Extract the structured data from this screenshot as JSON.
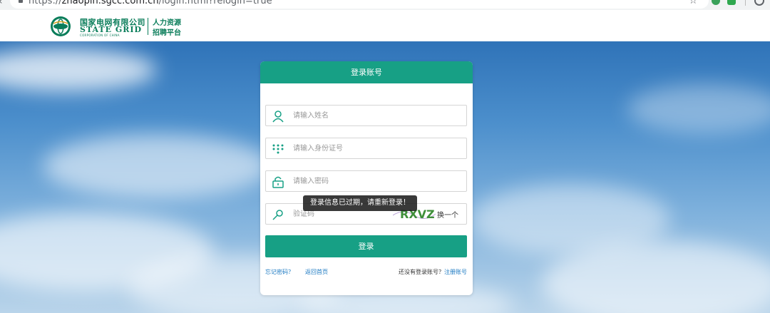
{
  "browser": {
    "url_prefix": "https://",
    "url_host": "zhaopin.sgcc.com.cn",
    "url_path": "/login.html?relogin=true"
  },
  "header": {
    "logo_cn": "国家电网有限公司",
    "logo_en": "STATE GRID",
    "logo_sub": "CORPORATION OF CHINA",
    "hr_line1": "人力资源",
    "hr_line2": "招聘平台",
    "brand_color": "#0a7d5a"
  },
  "login": {
    "title": "登录账号",
    "name_placeholder": "请输入姓名",
    "id_placeholder": "请输入身份证号",
    "password_placeholder": "请输入密码",
    "captcha_placeholder": "验证码",
    "captcha_text": "RXVZ",
    "refresh_label": "换一个",
    "toast": "登录信息已过期，请重新登录！",
    "submit_label": "登录",
    "forgot_label": "忘记密码？",
    "home_label": "返回首页",
    "no_account_text": "还没有登录账号？",
    "register_label": "注册账号",
    "accent_color": "#17a085"
  }
}
